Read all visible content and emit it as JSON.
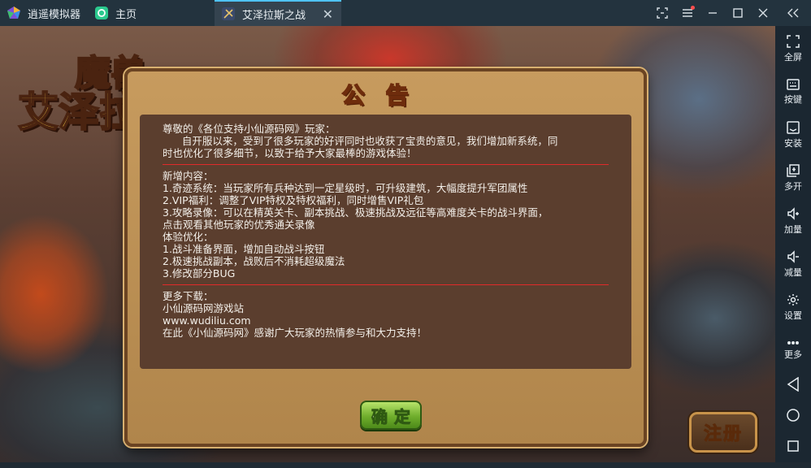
{
  "titlebar": {
    "app_name": "逍遥模拟器",
    "home_tab": "主页",
    "game_tab": "艾泽拉斯之战",
    "close_glyph": "✕"
  },
  "sidebar": {
    "items": [
      {
        "label": "全屏",
        "icon": "fullscreen-icon"
      },
      {
        "label": "按键",
        "icon": "keyboard-icon"
      },
      {
        "label": "安装",
        "icon": "apk-icon"
      },
      {
        "label": "多开",
        "icon": "multi-instance-icon"
      },
      {
        "label": "加量",
        "icon": "volume-up-icon"
      },
      {
        "label": "减量",
        "icon": "volume-down-icon"
      },
      {
        "label": "设置",
        "icon": "gear-icon"
      },
      {
        "label": "更多",
        "icon": "more-icon"
      }
    ],
    "nav": [
      "back-icon",
      "home-icon",
      "recent-apps-icon"
    ]
  },
  "game": {
    "logo_top": "魔兽",
    "logo_bottom": "艾泽拉斯之战",
    "register_label": "注册"
  },
  "notice": {
    "title": "公告",
    "greeting": "尊敬的《各位支持小仙源码网》玩家：",
    "intro_1": "      自开服以来，受到了很多玩家的好评同时也收获了宝贵的意见，我们增加新系统，同",
    "intro_2": "时也优化了很多细节，以致于给予大家最棒的游戏体验！",
    "new_heading": "新增内容：",
    "new_1": "1.奇迹系统：当玩家所有兵种达到一定星级时，可升级建筑，大幅度提升军团属性",
    "new_2": "2.VIP福利：调整了VIP特权及特权福利，同时增售VIP礼包",
    "new_3a": "3.攻略录像：可以在精英关卡、副本挑战、极速挑战及远征等高难度关卡的战斗界面，",
    "new_3b": "点击观看其他玩家的优秀通关录像",
    "opt_heading": "体验优化：",
    "opt_1": "1.战斗准备界面，增加自动战斗按钮",
    "opt_2": "2.极速挑战副本，战败后不消耗超级魔法",
    "opt_3": "3.修改部分BUG",
    "more_heading": "更多下载：",
    "more_site": "小仙源码网游戏站",
    "more_url": "www.wudiliu.com",
    "thanks": "在此《小仙源码网》感谢广大玩家的热情参与和大力支持！",
    "confirm_label": "确定"
  },
  "colors": {
    "titlebar_bg": "#23333e",
    "sidebar_bg": "#1b2731",
    "dialog_frame": "#c79b5e",
    "dialog_panel": "#5b3e2e",
    "divider": "#e02a2a",
    "title_gold": "#ffd33b",
    "confirm_green": "#6fae2c"
  }
}
